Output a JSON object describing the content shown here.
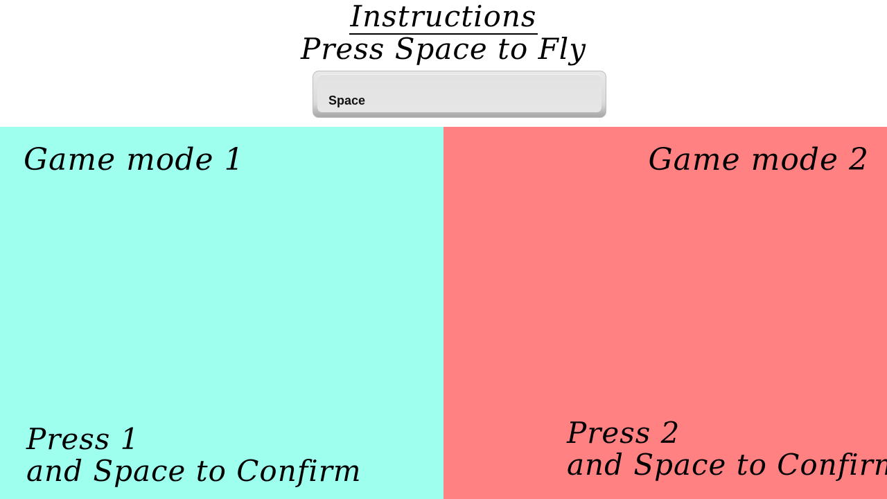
{
  "header": {
    "title": "Instructions",
    "subtitle": "Press Space to Fly",
    "key_label": "Space"
  },
  "modes": [
    {
      "title": "Game mode 1",
      "line1": "Press 1",
      "line2": "and Space to Confirm",
      "color": "#9effef"
    },
    {
      "title": "Game mode 2",
      "line1": "Press 2",
      "line2": "and Space to Confirm",
      "color": "#ff8181"
    }
  ]
}
